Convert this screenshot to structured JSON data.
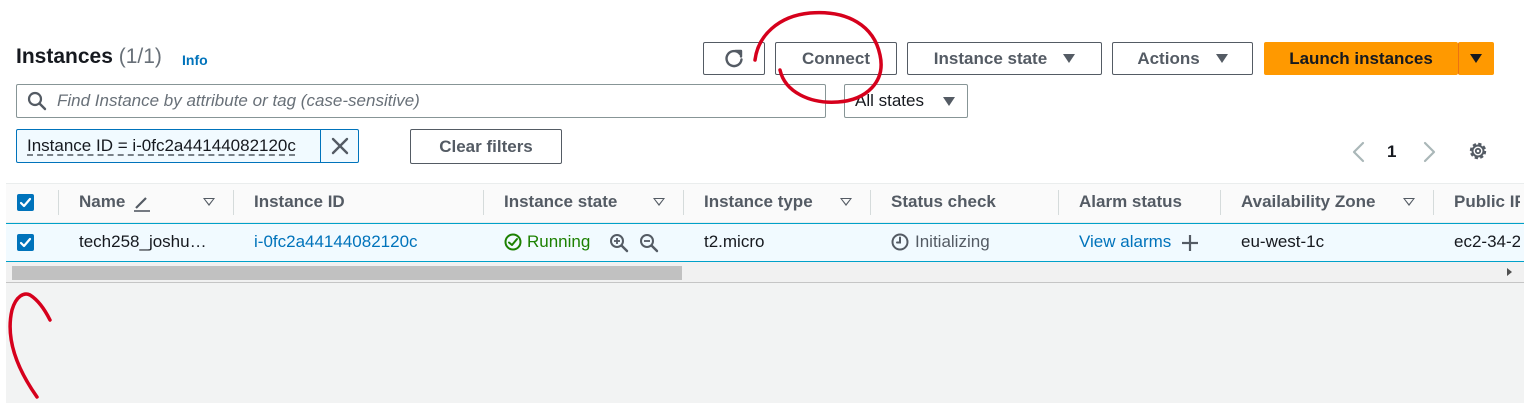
{
  "header": {
    "title": "Instances",
    "count": "(1/1)",
    "info_label": "Info"
  },
  "toolbar": {
    "connect_label": "Connect",
    "instance_state_label": "Instance state",
    "actions_label": "Actions",
    "launch_label": "Launch instances"
  },
  "search": {
    "placeholder": "Find Instance by attribute or tag (case-sensitive)",
    "value": "",
    "states_selected": "All states"
  },
  "filters": {
    "token_label": "Instance ID = i-0fc2a44144082120c",
    "clear_label": "Clear filters"
  },
  "pagination": {
    "current_page": "1"
  },
  "table": {
    "columns": [
      "Name",
      "Instance ID",
      "Instance state",
      "Instance type",
      "Status check",
      "Alarm status",
      "Availability Zone",
      "Public IP"
    ],
    "rows": [
      {
        "name": "tech258_joshu…",
        "instance_id": "i-0fc2a44144082120c",
        "state": "Running",
        "type": "t2.micro",
        "status_check": "Initializing",
        "alarm": "View alarms",
        "zone": "eu-west-1c",
        "public": "ec2-34-2"
      }
    ]
  },
  "colors": {
    "primary": "#ff9900",
    "link": "#0073bb",
    "running": "#1d8102",
    "annotation": "#d6001c"
  },
  "icons": {
    "refresh": "refresh-icon",
    "search": "search-icon",
    "close": "close-icon",
    "settings": "gear-icon",
    "edit": "pencil-icon",
    "zoom_in": "zoom-in-icon",
    "zoom_out": "zoom-out-icon",
    "running": "check-circle-icon",
    "initializing": "clock-icon",
    "add": "plus-icon"
  }
}
